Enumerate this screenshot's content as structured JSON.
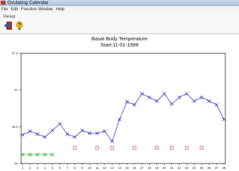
{
  "window": {
    "title": "Ovulating Calendar"
  },
  "menu": [
    "File",
    "Edit",
    "Function",
    "Window",
    "Help"
  ],
  "toolbar": {
    "period_label": "Period",
    "exit_icon": "exit-door-icon",
    "help_icon": "help-question-icon"
  },
  "chart_data": {
    "type": "line",
    "title": "Basal Body Temperature",
    "subtitle": "Start:11-01-1999",
    "x": [
      1,
      2,
      3,
      4,
      5,
      6,
      7,
      8,
      9,
      10,
      11,
      12,
      13,
      14,
      15,
      16,
      17,
      18,
      19,
      20,
      21,
      22,
      23,
      24,
      25,
      26,
      27,
      28
    ],
    "x_ticks": [
      "1",
      "2",
      "3",
      "4",
      "5",
      "6",
      "7",
      "8",
      "9",
      "10",
      "11",
      "12",
      "13",
      "14",
      "15",
      "16",
      "17",
      "18",
      "19",
      "20",
      "21",
      "22",
      "23",
      "24",
      "25",
      "26",
      "27",
      "28"
    ],
    "y_ticks": [
      "36",
      "36.5",
      "37",
      "37.5"
    ],
    "ylim": [
      36,
      37.5
    ],
    "xlim": [
      1,
      28
    ],
    "series": [
      {
        "marker": "x",
        "color": "#3535c8",
        "values": [
          36.39,
          36.44,
          36.4,
          36.36,
          36.45,
          36.54,
          36.4,
          36.36,
          36.45,
          36.41,
          36.41,
          36.44,
          36.3,
          36.6,
          36.84,
          36.8,
          36.95,
          36.9,
          36.85,
          36.95,
          36.81,
          36.9,
          36.95,
          36.85,
          36.9,
          36.85,
          36.8,
          36.6
        ]
      }
    ],
    "period_days": [
      1,
      2,
      3,
      4,
      5
    ],
    "period_color": "#3cb043",
    "square_days": [
      8,
      11,
      13,
      16,
      19,
      21,
      23,
      25
    ],
    "square_color": "#d04040"
  }
}
